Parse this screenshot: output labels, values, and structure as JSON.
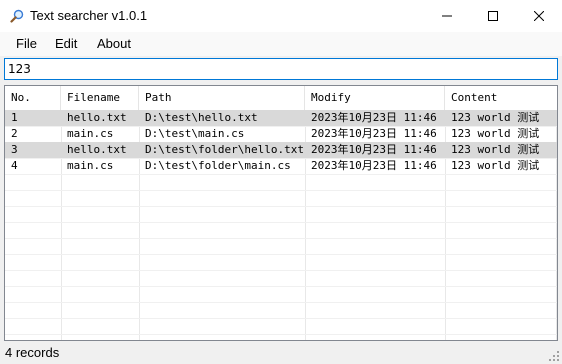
{
  "window": {
    "title": "Text searcher v1.0.1",
    "icon": "magnifier-icon"
  },
  "menu": {
    "file": "File",
    "edit": "Edit",
    "about": "About"
  },
  "search": {
    "value": "123",
    "placeholder": ""
  },
  "table": {
    "columns": [
      "No.",
      "Filename",
      "Path",
      "Modify",
      "Content"
    ],
    "rows": [
      [
        "1",
        "hello.txt",
        "D:\\test\\hello.txt",
        "2023年10月23日 11:46",
        "123 world 测试"
      ],
      [
        "2",
        "main.cs",
        "D:\\test\\main.cs",
        "2023年10月23日 11:46",
        "123 world 测试"
      ],
      [
        "3",
        "hello.txt",
        "D:\\test\\folder\\hello.txt",
        "2023年10月23日 11:46",
        "123 world 测试"
      ],
      [
        "4",
        "main.cs",
        "D:\\test\\folder\\main.cs",
        "2023年10月23日 11:46",
        "123 world 测试"
      ]
    ]
  },
  "status": {
    "text": "4 records"
  },
  "colors": {
    "selected_row": "#d9d9d9",
    "focus_border": "#0078d7"
  }
}
